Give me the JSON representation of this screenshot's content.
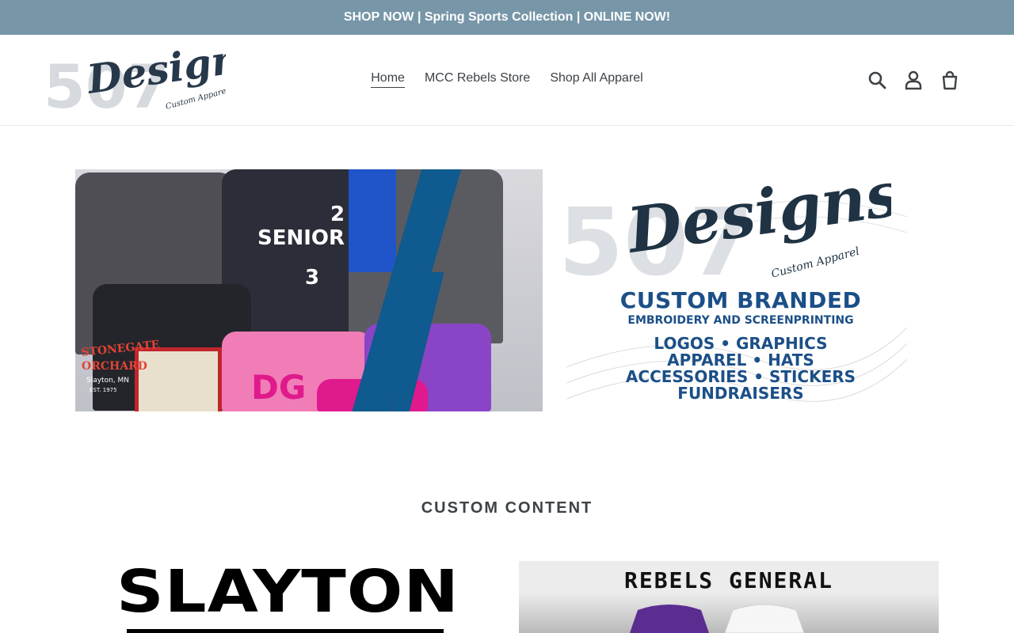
{
  "announcement": {
    "text": "SHOP NOW | Spring Sports Collection | ONLINE NOW!"
  },
  "header": {
    "logo": {
      "number": "507",
      "word": "Designs",
      "tagline": "Custom Apparel"
    },
    "nav": [
      {
        "label": "Home",
        "active": true
      },
      {
        "label": "MCC Rebels Store",
        "active": false
      },
      {
        "label": "Shop All Apparel",
        "active": false
      }
    ],
    "icons": [
      "search-icon",
      "account-icon",
      "cart-icon"
    ]
  },
  "hero": {
    "logo": {
      "number": "507",
      "word": "Designs",
      "tagline": "Custom Apparel"
    },
    "headline": "CUSTOM BRANDED",
    "subheadline": "EMBROIDERY AND SCREENPRINTING",
    "lines": [
      "LOGOS • GRAPHICS",
      "APPAREL • HATS",
      "ACCESSORIES • STICKERS",
      "FUNDRAISERS"
    ],
    "products": {
      "shirt_senior": "SENIOR",
      "year_top": "2",
      "year_bottom": "3",
      "orchard_1": "STONEGATE",
      "orchard_2": "ORCHARD",
      "orchard_3": "Slayton, MN",
      "orchard_4": "EST. 1975",
      "pink_shirt": "DG"
    }
  },
  "section": {
    "title": "CUSTOM CONTENT"
  },
  "cards": [
    {
      "title": "SLAYTON"
    },
    {
      "title": "REBELS GENERAL"
    }
  ],
  "colors": {
    "announcement_bg": "#7796a8",
    "brand_blue": "#1b4f87",
    "text": "#3d4246"
  }
}
